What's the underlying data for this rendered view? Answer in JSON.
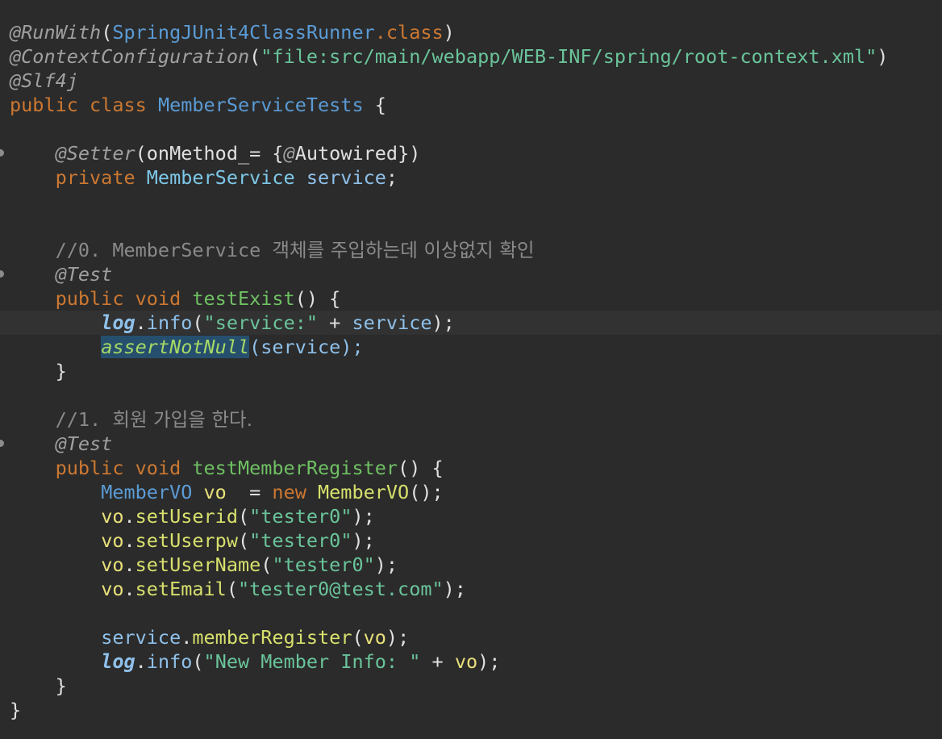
{
  "editor": {
    "l1": {
      "a": "@RunWith",
      "b": "(",
      "c": "SpringJUnit4ClassRunner",
      "d": ".class",
      "e": ")"
    },
    "l2": {
      "a": "@ContextConfiguration",
      "b": "(",
      "c": "\"file:src/main/webapp/WEB-INF/spring/root-context.xml\"",
      "d": ")"
    },
    "l3": {
      "a": "@Slf4j"
    },
    "l4": {
      "a": "public class ",
      "b": "MemberServiceTests",
      "c": " {"
    },
    "l6": {
      "a": "@Setter",
      "b": "(onMethod_= {",
      "c": "@",
      "d": "Autowired})"
    },
    "l7": {
      "a": "private ",
      "b": "MemberService ",
      "c": "service",
      "d": ";"
    },
    "l10": {
      "a": "//0. MemberService ",
      "b": "객체를 주입하는데 이상없지 확인"
    },
    "l11": {
      "a": "@Test"
    },
    "l12": {
      "a": "public void ",
      "b": "testExist",
      "c": "() {"
    },
    "l13": {
      "a": "log",
      "b": ".",
      "c": "info",
      "d": "(",
      "e": "\"service:\"",
      "f": " + ",
      "g": "service",
      "h": ");"
    },
    "l14": {
      "a": "assertNotNull",
      "b": "(service);"
    },
    "l15": {
      "a": "}"
    },
    "l17": {
      "a": "//1. ",
      "b": "회원 가입을 한다."
    },
    "l18": {
      "a": "@Test"
    },
    "l19": {
      "a": "public void ",
      "b": "testMemberRegister",
      "c": "() {"
    },
    "l20": {
      "a": "MemberVO ",
      "b": "vo",
      "c": "  = ",
      "d": "new ",
      "e": "MemberVO",
      "f": "();"
    },
    "l21": {
      "a": "vo",
      "b": ".",
      "c": "setUserid",
      "d": "(",
      "e": "\"tester0\"",
      "f": ");"
    },
    "l22": {
      "a": "vo",
      "b": ".",
      "c": "setUserpw",
      "d": "(",
      "e": "\"tester0\"",
      "f": ");"
    },
    "l23": {
      "a": "vo",
      "b": ".",
      "c": "setUserName",
      "d": "(",
      "e": "\"tester0\"",
      "f": ");"
    },
    "l24": {
      "a": "vo",
      "b": ".",
      "c": "setEmail",
      "d": "(",
      "e": "\"tester0@test.com\"",
      "f": ");"
    },
    "l26": {
      "a": "service",
      "b": ".",
      "c": "memberRegister",
      "d": "(",
      "e": "vo",
      "f": ");"
    },
    "l27": {
      "a": "log",
      "b": ".",
      "c": "info",
      "d": "(",
      "e": "\"New Member Info: \"",
      "f": " + ",
      "g": "vo",
      "h": ");"
    },
    "l28": {
      "a": "}"
    },
    "l29": {
      "a": "}"
    }
  },
  "colors": {
    "background": "#2b2b2b",
    "current_line": "#323232",
    "keyword": "#cc7832",
    "string": "#6ac49a",
    "comment": "#8a8a8a",
    "selection": "#264f6e"
  }
}
